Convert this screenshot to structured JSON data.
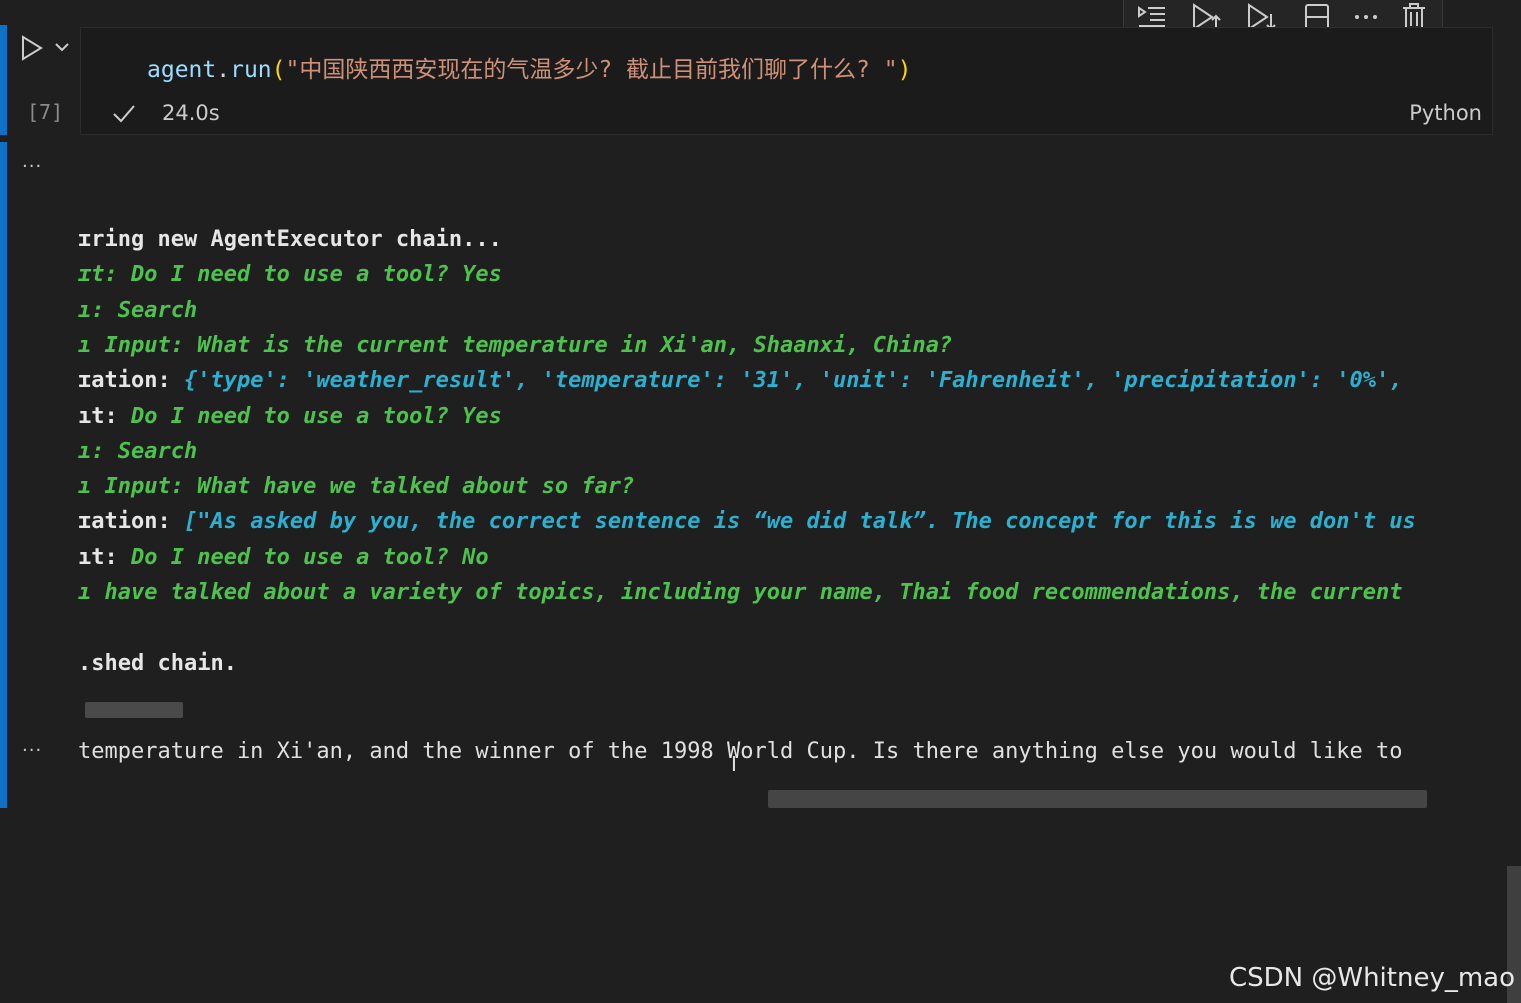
{
  "cell": {
    "execution_count": "[7]",
    "code": {
      "fn": "agent",
      "dot": ".",
      "method": "run",
      "open_paren": "(",
      "string": "\"中国陕西西安现在的气温多少? 截止目前我们聊了什么? \"",
      "close_paren": ")"
    },
    "status_time": "24.0s",
    "language": "Python"
  },
  "toolbar": {
    "icons": [
      "run-by-line-icon",
      "execute-above-icon",
      "execute-below-icon",
      "split-cell-icon",
      "more-icon",
      "delete-icon"
    ]
  },
  "output": {
    "menu_glyph": "···",
    "lines": [
      [
        {
          "t": "ɪring new AgentExecutor chain...",
          "c": "bold-w"
        }
      ],
      [
        {
          "t": "ɪt: Do I need to use a tool? Yes",
          "c": "green-i"
        }
      ],
      [
        {
          "t": "ı: Search",
          "c": "green-i"
        }
      ],
      [
        {
          "t": "ı Input: What is the current temperature in Xi'an, Shaanxi, China?",
          "c": "green-i"
        }
      ],
      [
        {
          "t": "ɪation: ",
          "c": "white-b"
        },
        {
          "t": "{'type': 'weather_result', 'temperature': '31', 'unit': 'Fahrenheit', 'precipitation': '0%',",
          "c": "cyan-i"
        }
      ],
      [
        {
          "t": "ıt: ",
          "c": "white-b"
        },
        {
          "t": "Do I need to use a tool? Yes",
          "c": "green-i"
        }
      ],
      [
        {
          "t": "ı: Search",
          "c": "green-i"
        }
      ],
      [
        {
          "t": "ı Input: What have we talked about so far?",
          "c": "green-i"
        }
      ],
      [
        {
          "t": "ɪation: ",
          "c": "white-b"
        },
        {
          "t": "[\"As asked by you, the correct sentence is “we did talk”. The concept for this is we don't us",
          "c": "cyan-i"
        }
      ],
      [
        {
          "t": "ıt: ",
          "c": "white-b"
        },
        {
          "t": "Do I need to use a tool? No",
          "c": "green-i"
        }
      ],
      [
        {
          "t": "ı have talked about a variety of topics, including your name, Thai food recommendations, the current",
          "c": "green-i"
        }
      ],
      [
        {
          "t": "",
          "c": "plain"
        }
      ],
      [
        {
          "t": ".shed chain.",
          "c": "bold-w"
        }
      ]
    ],
    "result_menu_glyph": "···",
    "result_text": "temperature in Xi'an, and the winner of the 1998 World Cup. Is there anything else you would like to"
  },
  "watermark": "CSDN @Whitney_mao",
  "colors": {
    "background": "#1f1f1f",
    "cell_bar": "#0e71c7",
    "green_text": "#4ec24e",
    "cyan_text": "#2ab1d1",
    "string": "#ce9178"
  }
}
